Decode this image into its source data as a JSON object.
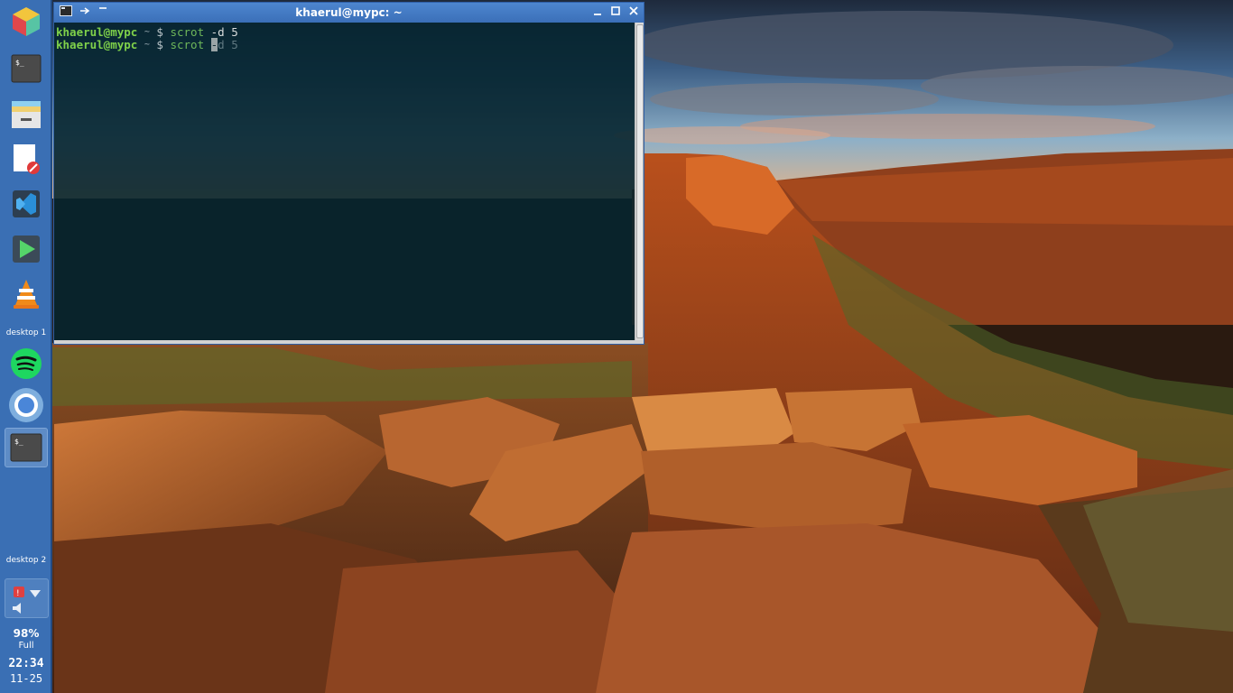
{
  "desktop": {
    "wallpaper": "outback-canyon-sunset"
  },
  "panel": {
    "launchers": [
      {
        "name": "app-launcher-cube-icon"
      },
      {
        "name": "terminal-icon"
      },
      {
        "name": "file-manager-icon"
      },
      {
        "name": "text-editor-icon"
      },
      {
        "name": "vscode-icon"
      },
      {
        "name": "media-player-icon"
      },
      {
        "name": "vlc-icon"
      }
    ],
    "desktop1_label": "desktop 1",
    "desktop2_label": "desktop 2",
    "tasks": [
      {
        "name": "spotify-icon"
      },
      {
        "name": "chromium-icon"
      },
      {
        "name": "terminal-task-icon"
      }
    ],
    "battery": {
      "percent": "98%",
      "state": "Full"
    },
    "clock": {
      "time": "22:34",
      "date": "11-25"
    }
  },
  "terminal": {
    "title": "khaerul@mypc: ~",
    "lines": [
      {
        "user": "khaerul@mypc",
        "dir": "~",
        "prompt": "$",
        "cmd": "scrot",
        "args": "-d 5"
      },
      {
        "user": "khaerul@mypc",
        "dir": "~",
        "prompt": "$",
        "cmd": "scrot",
        "cursor": "-",
        "args": "d 5"
      }
    ]
  },
  "colors": {
    "panel": "#3a6fb4",
    "titlebar": "#3f75bf",
    "terminal_bg": "#0a2630",
    "prompt_user": "#7fd14a"
  }
}
